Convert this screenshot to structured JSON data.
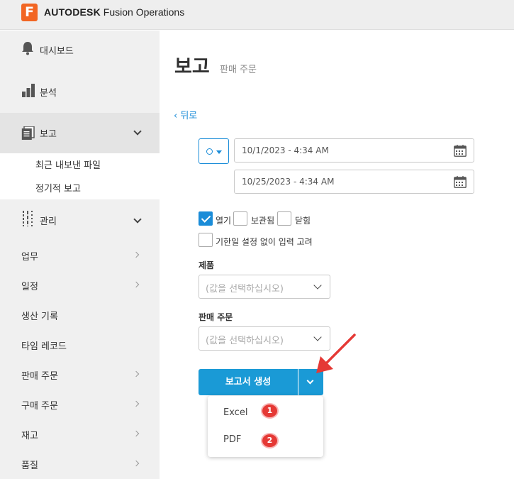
{
  "app": {
    "logo_letter": "F",
    "brand_bold": "AUTODESK",
    "brand_rest": " Fusion Operations",
    "brand_color": "#f26522"
  },
  "sidebar": {
    "dashboard": "대시보드",
    "analysis": "분석",
    "reports": "보고",
    "reports_sub": [
      "최근 내보낸 파일",
      "정기적 보고"
    ],
    "manage": "관리",
    "items": [
      "업무",
      "일정",
      "생산 기록",
      "타임 레코드",
      "판매 주문",
      "구매 주문",
      "재고",
      "품질"
    ]
  },
  "main": {
    "title": "보고",
    "subtitle": "판매 주문",
    "back": "‹ 뒤로",
    "date_from": "10/1/2023 - 4:34 AM",
    "date_to": "10/25/2023 - 4:34 AM",
    "status_filters": [
      {
        "label": "열기",
        "checked": true
      },
      {
        "label": "보관됨",
        "checked": false
      },
      {
        "label": "닫힘",
        "checked": false
      }
    ],
    "no_deadline_label": "기한일 설정 없이 입력 고려",
    "product_label": "제품",
    "product_placeholder": "(값을 선택하십시오)",
    "sales_order_label": "판매 주문",
    "sales_order_placeholder": "(값을 선택하십시오)",
    "generate_button": "보고서 생성",
    "accent_color": "#1a9ad6"
  },
  "export_menu": {
    "items": [
      "Excel",
      "PDF"
    ],
    "badges": [
      "1",
      "2"
    ]
  }
}
